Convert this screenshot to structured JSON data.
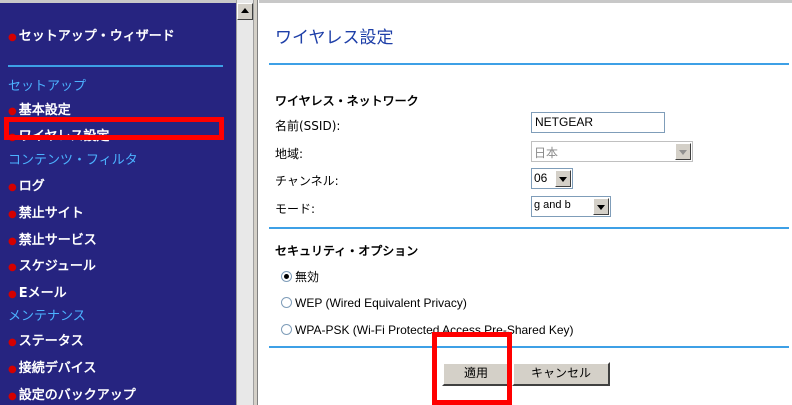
{
  "sidebar": {
    "setup_wizard": "セットアップ・ウィザード",
    "section_setup": "セットアップ",
    "basic_settings": "基本設定",
    "wireless_settings": "ワイヤレス設定",
    "section_content_filter": "コンテンツ・フィルタ",
    "logs": "ログ",
    "blocked_sites": "禁止サイト",
    "blocked_services": "禁止サービス",
    "schedule": "スケジュール",
    "email": "Eメール",
    "section_maintenance": "メンテナンス",
    "status": "ステータス",
    "attached_devices": "接続デバイス",
    "backup_settings": "設定のバックアップ"
  },
  "main": {
    "title": "ワイヤレス設定",
    "network_section": "ワイヤレス・ネットワーク",
    "ssid_label": "名前(SSID):",
    "ssid_value": "NETGEAR",
    "region_label": "地域:",
    "region_value": "日本",
    "channel_label": "チャンネル:",
    "channel_value": "06",
    "mode_label": "モード:",
    "mode_value": "g and b",
    "security_section": "セキュリティ・オプション",
    "opt_disabled": "無効",
    "opt_wep": "WEP (Wired Equivalent Privacy)",
    "opt_wpa": "WPA-PSK (Wi-Fi Protected Access Pre-Shared Key)",
    "apply_button": "適用",
    "cancel_button": "キャンセル"
  },
  "colors": {
    "sidebar_bg": "#262480",
    "section_header": "#4cb2ff",
    "bullet": "#d40000",
    "title": "#1e3fa8",
    "rule": "#3da0e6",
    "highlight": "#ff0000"
  }
}
